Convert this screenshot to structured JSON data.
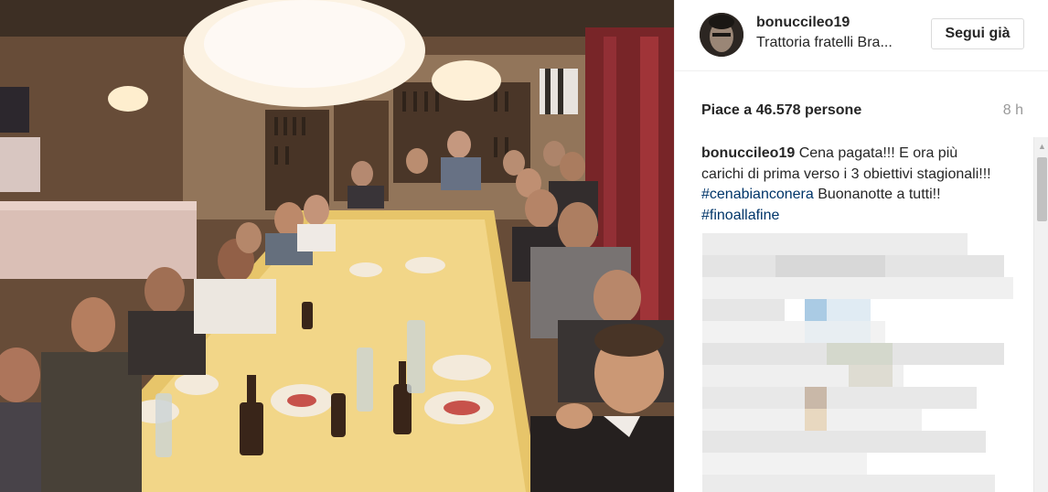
{
  "post": {
    "username": "bonuccileo19",
    "location": "Trattoria fratelli Bra...",
    "follow_label": "Segui già",
    "likes_text": "Piace a 46.578 persone",
    "time_ago": "8 h",
    "caption": {
      "username": "bonuccileo19",
      "text_1": "Cena pagata!!! E ora più carichi di prima verso i 3 obiettivi stagionali!!! ",
      "hashtag_1": "#cenabianconera",
      "text_2": " Buonanotte a tutti!! ",
      "hashtag_2": "#finoallafine"
    }
  },
  "colors": {
    "hashtag": "#003569",
    "secondary_text": "#999999",
    "border": "#dbdbdb"
  },
  "icons": {
    "scroll_up": "scroll-up-arrow-icon"
  }
}
